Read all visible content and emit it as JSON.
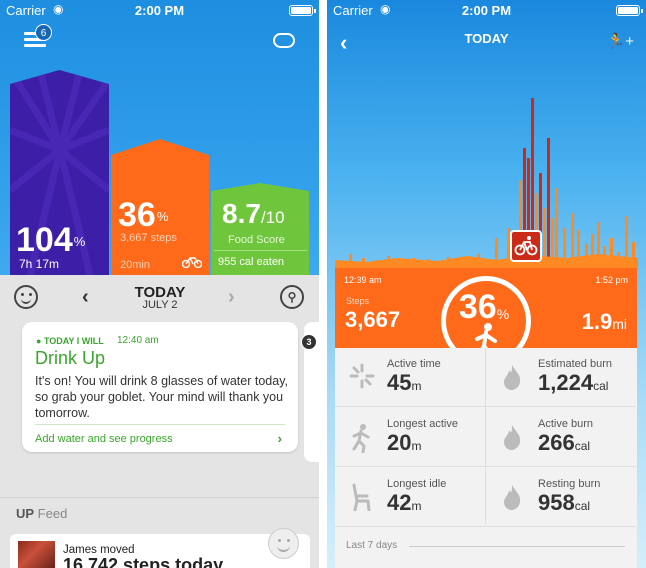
{
  "status": {
    "carrier": "Carrier",
    "time": "2:00 PM"
  },
  "left": {
    "menu_badge": "6",
    "sleep": {
      "value": "104",
      "unit": "%",
      "sub": "7h 17m"
    },
    "steps": {
      "value": "36",
      "unit": "%",
      "sub": "3,667 steps",
      "duration": "20min"
    },
    "food": {
      "value": "8.7",
      "denom": "/10",
      "label": "Food Score",
      "cal": "955 cal eaten"
    },
    "day": {
      "title": "TODAY",
      "date": "JULY 2"
    },
    "card": {
      "tag": "TODAY I WILL",
      "time": "12:40 am",
      "title": "Drink Up",
      "body": "It's on! You will drink 8 glasses of water today, so grab your goblet. Your mind will thank you tomorrow.",
      "link": "Add water and see progress"
    },
    "next_badge": "3",
    "feed": {
      "title_bold": "UP",
      "title_rest": " Feed",
      "name": "James moved",
      "steps": "16,742 steps today"
    }
  },
  "right": {
    "title": "TODAY",
    "start": "12:39 am",
    "end": "1:52 pm",
    "steps_label": "Steps",
    "steps": "3,667",
    "percent": "36",
    "percent_unit": "%",
    "distance": "1.9",
    "distance_unit": "mi",
    "stats": [
      {
        "label": "Active time",
        "value": "45",
        "unit": "m",
        "icon": "sparkle-icon"
      },
      {
        "label": "Estimated burn",
        "value": "1,224",
        "unit": "cal",
        "icon": "flame-icon"
      },
      {
        "label": "Longest active",
        "value": "20",
        "unit": "m",
        "icon": "runner-icon"
      },
      {
        "label": "Active burn",
        "value": "266",
        "unit": "cal",
        "icon": "flame-icon"
      },
      {
        "label": "Longest idle",
        "value": "42",
        "unit": "m",
        "icon": "chair-icon"
      },
      {
        "label": "Resting burn",
        "value": "958",
        "unit": "cal",
        "icon": "flame-icon"
      }
    ],
    "last7": "Last 7 days"
  },
  "colors": {
    "sleep": "#3d1ea6",
    "steps": "#ff6a1a",
    "food": "#6fc63c",
    "accent_green": "#3ca52e",
    "spike_red": "#cc2a18"
  }
}
